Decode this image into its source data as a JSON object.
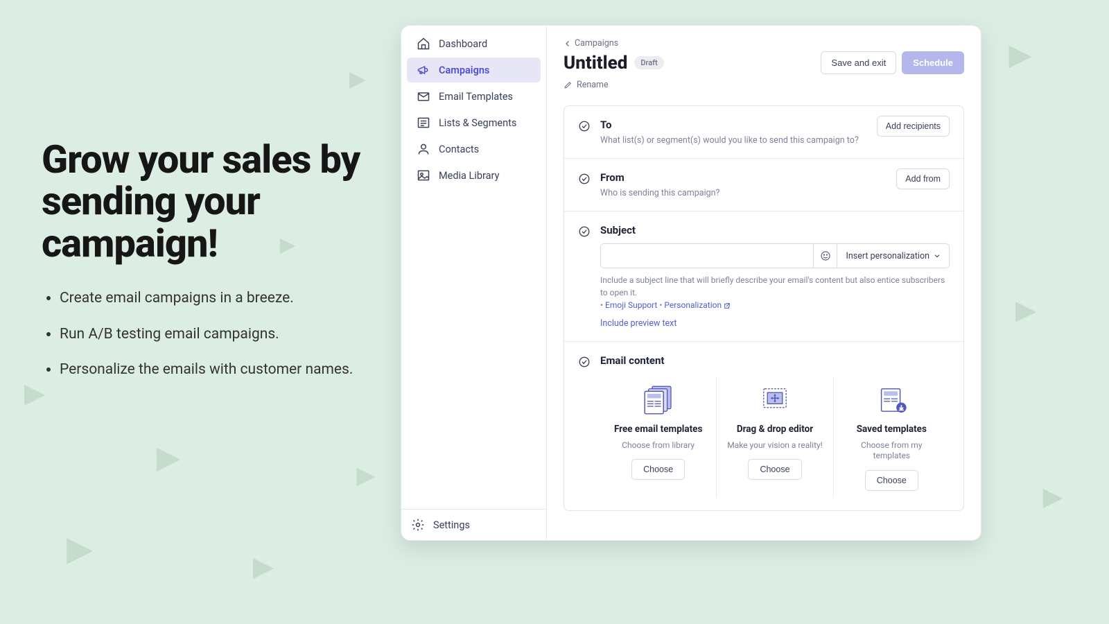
{
  "promo": {
    "headline": "Grow your sales by sending your campaign!",
    "bullets": [
      "Create email campaigns in a breeze.",
      "Run A/B testing email campaigns.",
      "Personalize the emails with customer names."
    ]
  },
  "sidebar": {
    "items": [
      {
        "label": "Dashboard"
      },
      {
        "label": "Campaigns"
      },
      {
        "label": "Email Templates"
      },
      {
        "label": "Lists & Segments"
      },
      {
        "label": "Contacts"
      },
      {
        "label": "Media Library"
      }
    ],
    "settings": "Settings"
  },
  "breadcrumb": "Campaigns",
  "page": {
    "title": "Untitled",
    "draft_badge": "Draft",
    "save_label": "Save and exit",
    "schedule_label": "Schedule",
    "rename_label": "Rename"
  },
  "to": {
    "title": "To",
    "sub": "What list(s) or segment(s) would you like to send this campaign to?",
    "button": "Add recipients"
  },
  "from": {
    "title": "From",
    "sub": "Who is sending this campaign?",
    "button": "Add from"
  },
  "subject": {
    "title": "Subject",
    "personalize": "Insert personalization",
    "help": "Include a subject line that will briefly describe your email's content but also entice subscribers to open it.",
    "link1": "Emoji Support",
    "link2": "Personalization",
    "preview": "Include preview text"
  },
  "content": {
    "title": "Email content",
    "options": [
      {
        "title": "Free email templates",
        "sub": "Choose from library",
        "button": "Choose"
      },
      {
        "title": "Drag & drop editor",
        "sub": "Make your vision a reality!",
        "button": "Choose"
      },
      {
        "title": "Saved templates",
        "sub": "Choose from my templates",
        "button": "Choose"
      }
    ]
  }
}
